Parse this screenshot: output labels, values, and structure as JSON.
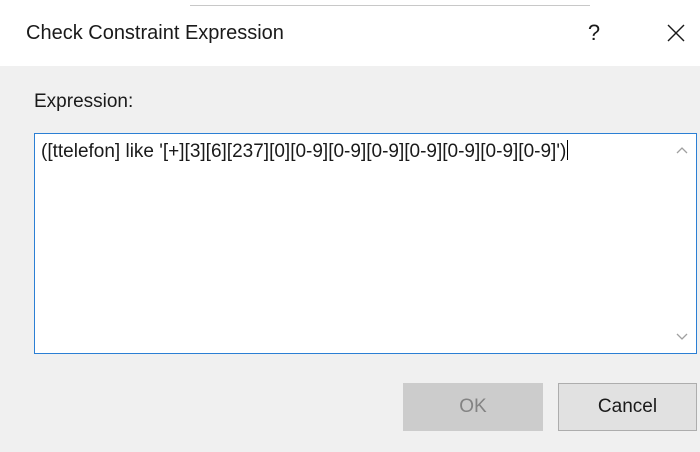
{
  "window": {
    "title": "Check Constraint Expression",
    "help_label": "?",
    "close_icon": "close-icon"
  },
  "form": {
    "expression_label": "Expression:",
    "expression_value": "([ttelefon] like '[+][3][6][237][0][0-9][0-9][0-9][0-9][0-9][0-9][0-9]')"
  },
  "buttons": {
    "ok_label": "OK",
    "ok_enabled": false,
    "cancel_label": "Cancel"
  },
  "colors": {
    "focus_border": "#2b7fd4",
    "disabled_button_bg": "#cccccc",
    "disabled_button_text": "#838383",
    "button_bg": "#e1e1e1",
    "dialog_bg": "#f0f0f0"
  }
}
